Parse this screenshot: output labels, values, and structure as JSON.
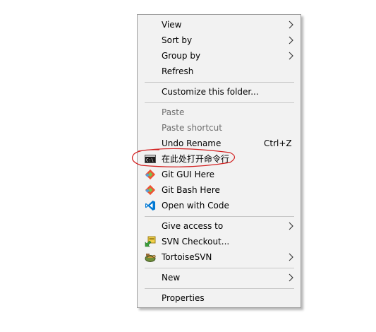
{
  "menu": {
    "items": [
      {
        "label": "View",
        "submenu": true
      },
      {
        "label": "Sort by",
        "submenu": true
      },
      {
        "label": "Group by",
        "submenu": true
      },
      {
        "label": "Refresh"
      },
      {
        "label": "Customize this folder..."
      },
      {
        "label": "Paste",
        "disabled": true
      },
      {
        "label": "Paste shortcut",
        "disabled": true
      },
      {
        "label": "Undo Rename",
        "shortcut": "Ctrl+Z"
      },
      {
        "label": "在此处打开命令行",
        "icon": "cmd-prompt-icon"
      },
      {
        "label": "Git GUI Here",
        "icon": "git-icon"
      },
      {
        "label": "Git Bash Here",
        "icon": "git-icon"
      },
      {
        "label": "Open with Code",
        "icon": "vscode-icon"
      },
      {
        "label": "Give access to",
        "submenu": true
      },
      {
        "label": "SVN Checkout...",
        "icon": "svn-checkout-icon"
      },
      {
        "label": "TortoiseSVN",
        "icon": "tortoisesvn-icon",
        "submenu": true
      },
      {
        "label": "New",
        "submenu": true
      },
      {
        "label": "Properties"
      }
    ]
  },
  "colors": {
    "menu_bg": "#f2f2f2",
    "border": "#a0a0a0",
    "disabled_text": "#6d6d6d",
    "annotation": "#d21f1f",
    "git": "#f05133",
    "vscode": "#0078d4"
  }
}
